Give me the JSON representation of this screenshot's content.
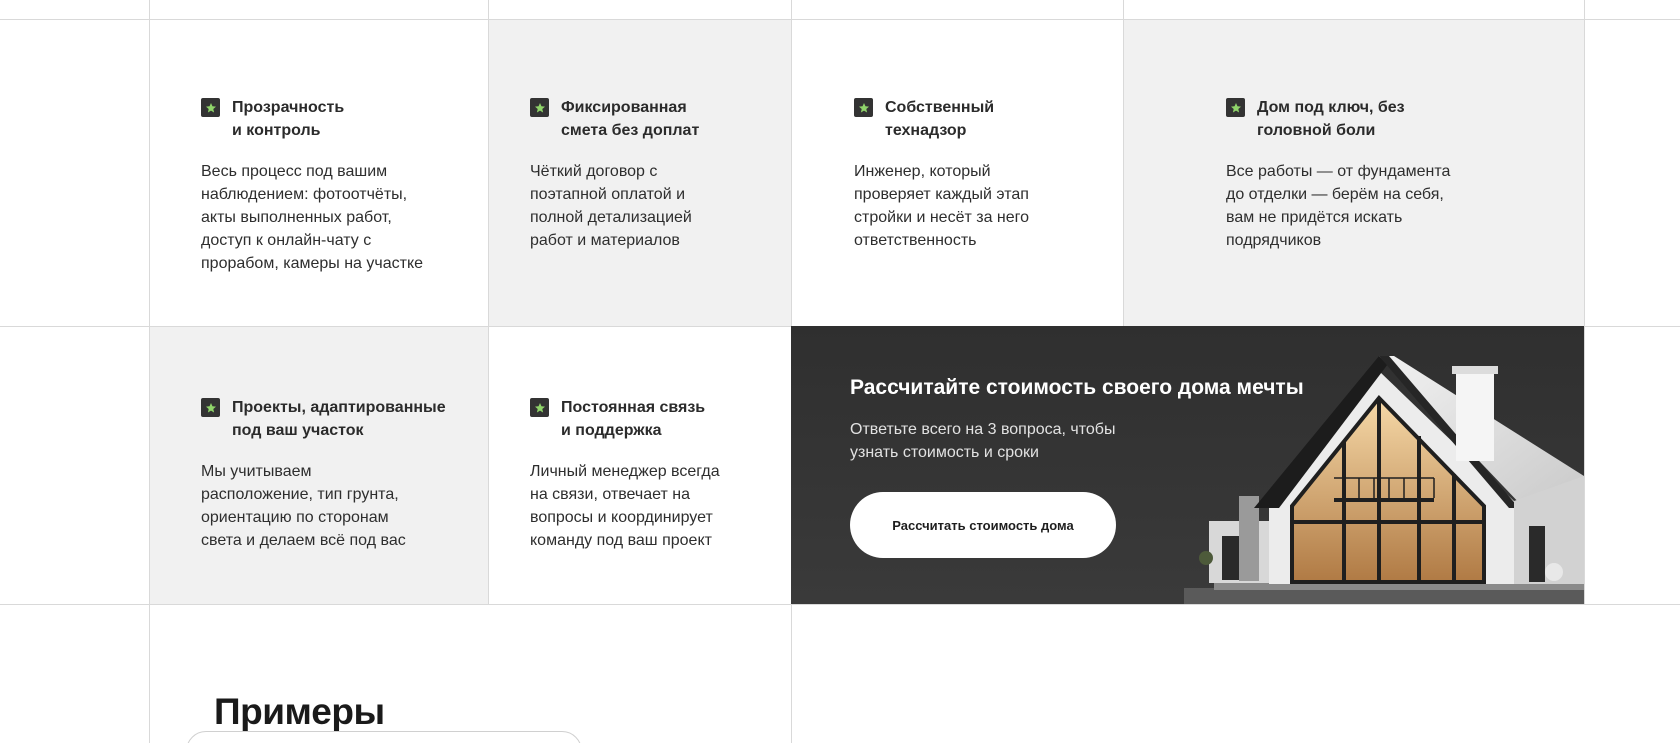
{
  "features": [
    {
      "title": "Прозрачность\nи контроль",
      "text": "Весь процесс под вашим\nнаблюдением: фотоотчёты,\nакты выполненных работ,\nдоступ к онлайн-чату с\nпрорабом, камеры на участке",
      "icon": "star-icon"
    },
    {
      "title": "Фиксированная\nсмета без доплат",
      "text": "Чёткий договор с\nпоэтапной оплатой и\nполной детализацией\nработ и материалов",
      "icon": "star-icon"
    },
    {
      "title": "Собственный\nтехнадзор",
      "text": "Инженер, который\nпроверяет каждый этап\nстройки и несёт за него\nответственность",
      "icon": "star-icon"
    },
    {
      "title": "Дом под ключ, без\nголовной боли",
      "text": "Все работы — от фундамента\nдо отделки — берём на себя,\nвам не придётся искать\nподрядчиков",
      "icon": "star-icon"
    },
    {
      "title": "Проекты, адаптированные\nпод ваш участок",
      "text": "Мы учитываем\nрасположение, тип грунта,\nориентацию по сторонам\nсвета и делаем всё под вас",
      "icon": "star-icon"
    },
    {
      "title": "Постоянная связь\nи поддержка",
      "text": "Личный менеджер всегда\nна связи, отвечает на\nвопросы и координирует\nкоманду под ваш проект",
      "icon": "star-icon"
    }
  ],
  "cta": {
    "title": "Рассчитайте стоимость своего дома мечты",
    "subtitle": "Ответьте всего на 3 вопроса, чтобы\nузнать стоимость и сроки",
    "button_label": "Рассчитать стоимость дома"
  },
  "examples": {
    "title": "Примеры"
  },
  "colors": {
    "star_badge": "#333333",
    "star": "#8fd46a",
    "gray_cell": "#f1f1f1",
    "cta_bg": "#333333"
  }
}
